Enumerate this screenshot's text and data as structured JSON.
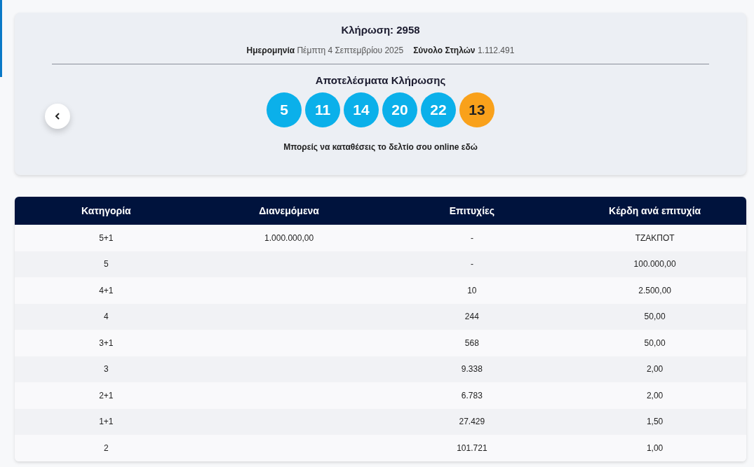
{
  "draw": {
    "title": "Κλήρωση: 2958",
    "date_label": "Ημερομηνία",
    "date_value": "Πέμπτη 4 Σεπτεμβρίου 2025",
    "columns_label": "Σύνολο Στηλών",
    "columns_value": "1.112.491",
    "results_title": "Αποτελέσματα Κλήρωσης",
    "balls": [
      {
        "number": "5",
        "color": "#0bb0ea"
      },
      {
        "number": "11",
        "color": "#0bb0ea"
      },
      {
        "number": "14",
        "color": "#0bb0ea"
      },
      {
        "number": "20",
        "color": "#0bb0ea"
      },
      {
        "number": "22",
        "color": "#0bb0ea"
      },
      {
        "number": "13",
        "color": "#f9a11b"
      }
    ],
    "online_text": "Μπορείς να καταθέσεις το δελτίο σου online εδώ"
  },
  "table": {
    "columns": [
      "Κατηγορία",
      "Διανεμόμενα",
      "Επιτυχίες",
      "Κέρδη ανά επιτυχία"
    ],
    "rows": [
      [
        "5+1",
        "1.000.000,00",
        "-",
        "ΤΖΑΚΠΟΤ"
      ],
      [
        "5",
        "",
        "-",
        "100.000,00"
      ],
      [
        "4+1",
        "",
        "10",
        "2.500,00"
      ],
      [
        "4",
        "",
        "244",
        "50,00"
      ],
      [
        "3+1",
        "",
        "568",
        "50,00"
      ],
      [
        "3",
        "",
        "9.338",
        "2,00"
      ],
      [
        "2+1",
        "",
        "6.783",
        "2,00"
      ],
      [
        "1+1",
        "",
        "27.429",
        "1,50"
      ],
      [
        "2",
        "",
        "101.721",
        "1,00"
      ]
    ]
  }
}
